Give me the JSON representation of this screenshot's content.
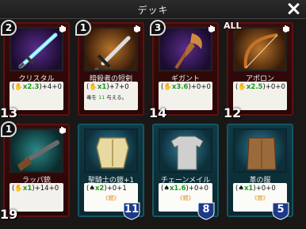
{
  "header": {
    "title": "デッキ"
  },
  "cards": [
    {
      "id": "crystal",
      "name": "クリスタル",
      "count": "2",
      "mult": "x2.3",
      "bonus": "+4+0",
      "cost": "13",
      "art": "blue-sword"
    },
    {
      "id": "assassin",
      "name": "暗殺者の短剣",
      "count": "1",
      "mult": "x1",
      "bonus": "+7+0",
      "sub_pre": "毒を ",
      "sub_num": "11",
      "sub_post": " 与える。",
      "cost": "",
      "art": "dagger"
    },
    {
      "id": "gigant",
      "name": "ギガント",
      "count": "3",
      "mult": "x3.6",
      "bonus": "+0+0",
      "cost": "14",
      "art": "axe"
    },
    {
      "id": "apollo",
      "name": "アポロン",
      "count_label": "ALL",
      "mult": "x2.5",
      "bonus": "+0+0",
      "cost": "12",
      "art": "bow"
    },
    {
      "id": "rappa",
      "name": "ラッパ銃",
      "count": "1",
      "mult": "x1",
      "bonus": "+14+0",
      "cost": "19",
      "art": "gun"
    },
    {
      "id": "holy_armor",
      "name": "聖騎士の鎧+1",
      "mult": "x2",
      "bonus": "+0+1",
      "note": "《鎧》",
      "defense": "11",
      "art": "armor"
    },
    {
      "id": "chainmail",
      "name": "チェーンメイル",
      "mult": "x1.6",
      "bonus": "+0+0",
      "note": "《鎧》",
      "defense": "8",
      "art": "chain"
    },
    {
      "id": "leather",
      "name": "革の服",
      "mult": "x1",
      "bonus": "+0+0",
      "note": "《鎧》",
      "defense": "5",
      "art": "leather"
    }
  ],
  "colors": {
    "red_frame": "#5a1212",
    "teal_frame": "#165563",
    "stat_green": "#1a9a1a"
  },
  "icons": [
    "close-icon",
    "hand-icon",
    "hand-stat-icon",
    "shield-icon"
  ]
}
